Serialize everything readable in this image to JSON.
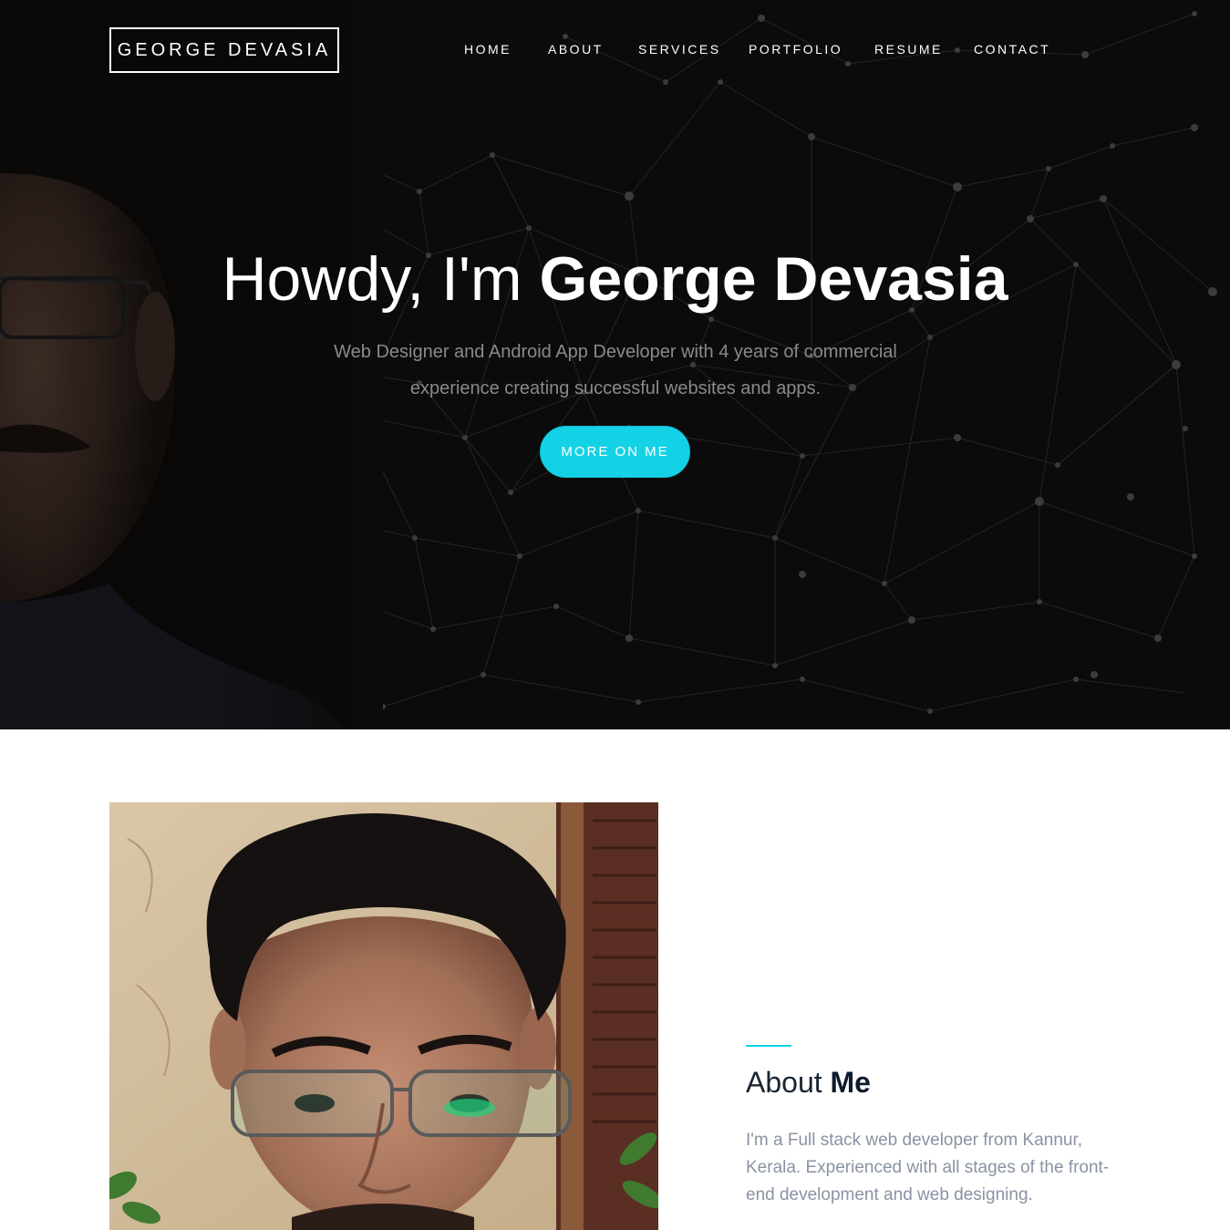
{
  "header": {
    "logo": "GEORGE DEVASIA",
    "nav": [
      "HOME",
      "ABOUT",
      "SERVICES",
      "PORTFOLIO",
      "RESUME",
      "CONTACT"
    ]
  },
  "hero": {
    "greeting": "Howdy, I'm",
    "name": "George Devasia",
    "subtitle": "Web Designer and Android App Developer with 4 years of commercial experience creating successful websites and apps.",
    "button": "MORE ON ME"
  },
  "about": {
    "title_light": "About",
    "title_bold": "Me",
    "paragraph": "I'm a Full stack web developer from Kannur, Kerala. Experienced with all stages of the front-end development and web designing."
  },
  "colors": {
    "accent": "#14d2e6",
    "hero_bg": "#0b0b0b",
    "heading_dark": "#0d1b2e",
    "body_text": "#8993a3"
  },
  "icons": []
}
